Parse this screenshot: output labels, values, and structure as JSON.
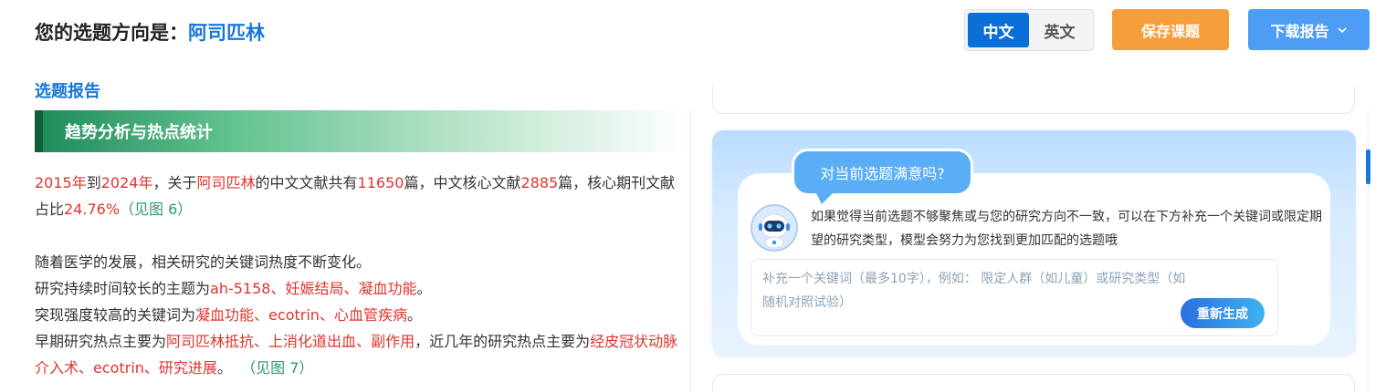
{
  "header": {
    "title_prefix": "您的选题方向是：",
    "topic": "阿司匹林"
  },
  "lang_toggle": {
    "options": [
      "中文",
      "英文"
    ],
    "selected": "中文"
  },
  "actions": {
    "save_label": "保存课题",
    "download_label": "下载报告"
  },
  "report_link": "选题报告",
  "section": {
    "title": "趋势分析与热点统计"
  },
  "paragraph1": {
    "year_start": "2015年",
    "to": "到",
    "year_end": "2024年",
    "t1": "，关于",
    "topic": "阿司匹林",
    "t2": "的中文文献共有",
    "count_all": "11650",
    "t3": "篇，中文核心文献",
    "count_core": "2885",
    "t4": "篇，核心期刊文献占比",
    "ratio": "24.76%",
    "fig_ref": "（见图 6）"
  },
  "paragraph2": {
    "line1": "随着医学的发展，相关研究的关键词热度不断变化。",
    "line2_prefix": "研究持续时间较长的主题为",
    "long_topics": [
      "ah-5158",
      "妊娠结局",
      "凝血功能"
    ],
    "line3_prefix": "突现强度较高的关键词为",
    "burst_keywords": [
      "凝血功能",
      "ecotrin",
      "心血管疾病"
    ],
    "line4_prefix": "早期研究热点主要为",
    "early_hotspots": [
      "阿司匹林抵抗",
      "上消化道出血",
      "副作用"
    ],
    "line4_mid": "，近几年的研究热点主要为",
    "recent_hotspots": [
      "经皮冠状动脉介入术",
      "ecotrin",
      "研究进展"
    ],
    "sep": "、",
    "end_mark": "。",
    "fig_ref": "（见图 7）"
  },
  "feedback": {
    "bubble": "对当前选题满意吗?",
    "helper": "如果觉得当前选题不够聚焦或与您的研究方向不一致，可以在下方补充一个关键词或限定期望的研究类型，模型会努力为您找到更加匹配的选题哦",
    "placeholder": "补充一个关键词（最多10字），例如： 限定人群（如儿童）或研究类型（如随机对照试验）",
    "regen_label": "重新生成"
  },
  "colors": {
    "accent_blue": "#1677d9",
    "highlight_red": "#e0332c",
    "ref_green": "#2f9b6b",
    "save_orange": "#f79e3c",
    "download_blue": "#4d9df4"
  }
}
